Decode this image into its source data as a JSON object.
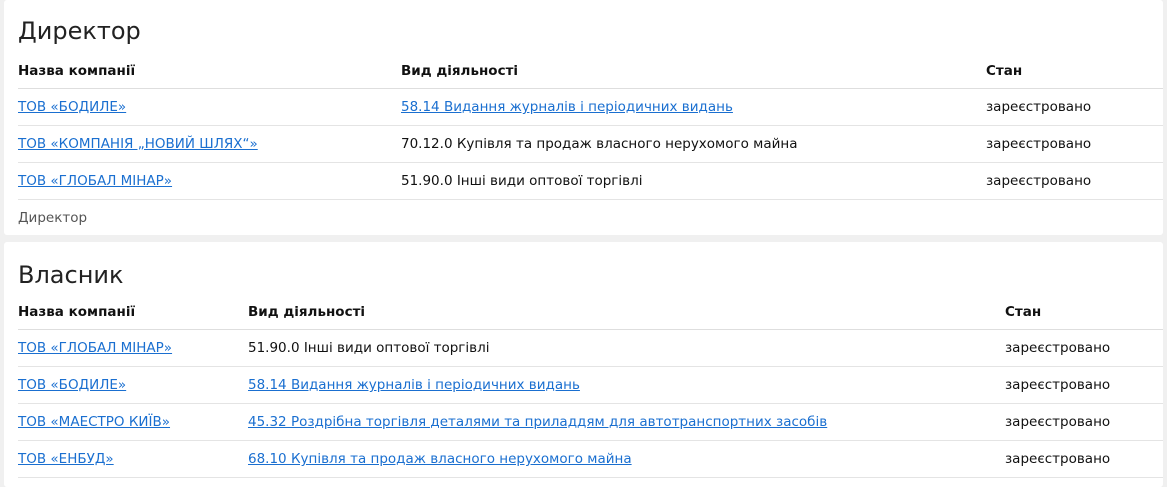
{
  "director": {
    "title": "Директор",
    "headers": [
      "Назва компанії",
      "Вид діяльності",
      "Стан"
    ],
    "rows": [
      {
        "company": "ТОВ «БОДИЛЕ»",
        "activity": "58.14 Видання журналів і періодичних видань",
        "activity_link": true,
        "status": "зареєстровано"
      },
      {
        "company": "ТОВ «КОМПАНІЯ „НОВИЙ ШЛЯХ“»",
        "activity": "70.12.0 Купівля та продаж власного нерухомого майна",
        "activity_link": false,
        "status": "зареєстровано"
      },
      {
        "company": "ТОВ «ГЛОБАЛ МІНАР»",
        "activity": "51.90.0 Інші види оптової торгівлі",
        "activity_link": false,
        "status": "зареєстровано"
      }
    ],
    "footer": "Директор"
  },
  "owner": {
    "title": "Власник",
    "headers": [
      "Назва компанії",
      "Вид діяльності",
      "Стан"
    ],
    "rows": [
      {
        "company": "ТОВ «ГЛОБАЛ МІНАР»",
        "activity": "51.90.0 Інші види оптової торгівлі",
        "activity_link": false,
        "status": "зареєстровано"
      },
      {
        "company": "ТОВ «БОДИЛЕ»",
        "activity": "58.14 Видання журналів і періодичних видань",
        "activity_link": true,
        "status": "зареєстровано"
      },
      {
        "company": "ТОВ «МАЕСТРО КИЇВ»",
        "activity": "45.32 Роздрібна торгівля деталями та приладдям для автотранспортних засобів",
        "activity_link": true,
        "status": "зареєстровано"
      },
      {
        "company": "ТОВ «ЕНБУД»",
        "activity": "68.10 Купівля та продаж власного нерухомого майна",
        "activity_link": true,
        "status": "зареєстровано"
      }
    ]
  },
  "colors": {
    "link": "#1a6fd0",
    "text": "#111111",
    "background": "#f0f0f0",
    "card": "#ffffff"
  }
}
